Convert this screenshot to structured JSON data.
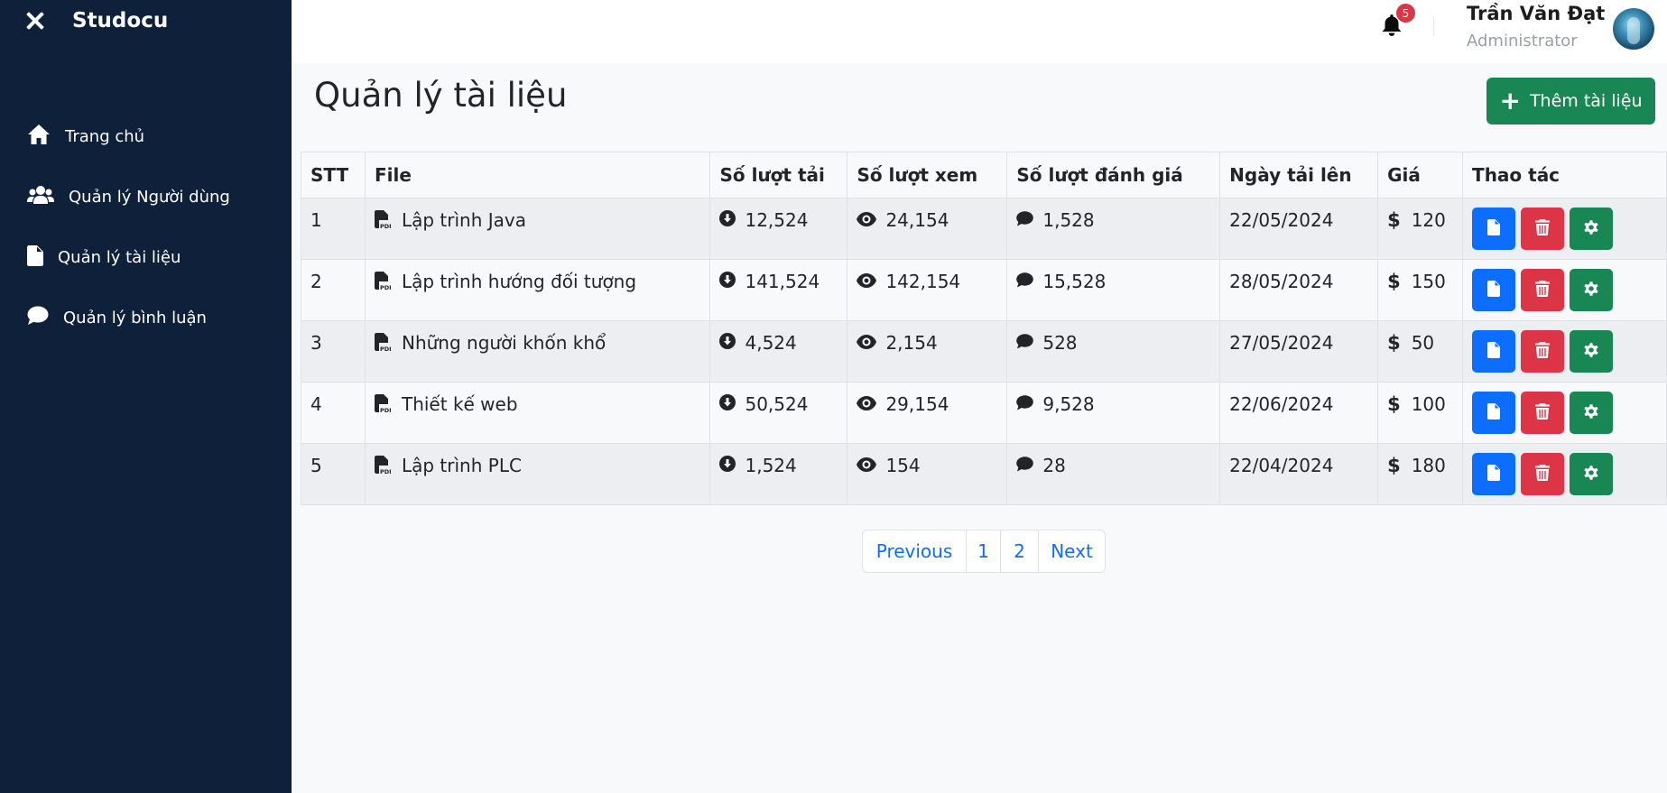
{
  "sidebar": {
    "brand": "Studocu",
    "items": [
      {
        "label": "Trang chủ",
        "icon": "home-icon"
      },
      {
        "label": "Quản lý Người dùng",
        "icon": "users-icon"
      },
      {
        "label": "Quản lý tài liệu",
        "icon": "file-icon"
      },
      {
        "label": "Quản lý bình luận",
        "icon": "comment-icon"
      }
    ]
  },
  "header": {
    "notification_count": "5",
    "user_name": "Trần Văn Đạt",
    "user_role": "Administrator"
  },
  "main": {
    "title": "Quản lý tài liệu",
    "add_button_label": "Thêm tài liệu",
    "table": {
      "columns": [
        "STT",
        "File",
        "Số lượt tải",
        "Số lượt xem",
        "Số lượt đánh giá",
        "Ngày tải lên",
        "Giá",
        "Thao tác"
      ],
      "rows": [
        {
          "stt": "1",
          "file": "Lập trình Java",
          "downloads": "12,524",
          "views": "24,154",
          "ratings": "1,528",
          "date": "22/05/2024",
          "price": "120"
        },
        {
          "stt": "2",
          "file": "Lập trình hướng đối tượng",
          "downloads": "141,524",
          "views": "142,154",
          "ratings": "15,528",
          "date": "28/05/2024",
          "price": "150"
        },
        {
          "stt": "3",
          "file": "Những người khốn khổ",
          "downloads": "4,524",
          "views": "2,154",
          "ratings": "528",
          "date": "27/05/2024",
          "price": "50"
        },
        {
          "stt": "4",
          "file": "Thiết kế web",
          "downloads": "50,524",
          "views": "29,154",
          "ratings": "9,528",
          "date": "22/06/2024",
          "price": "100"
        },
        {
          "stt": "5",
          "file": "Lập trình PLC",
          "downloads": "1,524",
          "views": "154",
          "ratings": "28",
          "date": "22/04/2024",
          "price": "180"
        }
      ]
    },
    "pagination": {
      "previous": "Previous",
      "pages": [
        "1",
        "2"
      ],
      "next": "Next"
    }
  },
  "colors": {
    "sidebar_bg": "#0f213a",
    "primary": "#0d6efd",
    "danger": "#dc3545",
    "success": "#198754"
  }
}
